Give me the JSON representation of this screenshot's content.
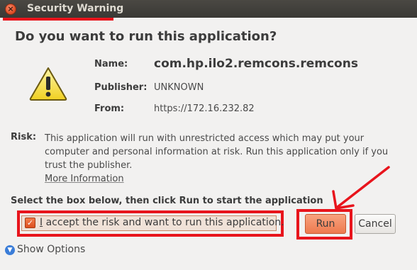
{
  "window": {
    "title": "Security Warning",
    "close_glyph": "×"
  },
  "dialog": {
    "question": "Do you want to run this application?",
    "name_label": "Name:",
    "name_value": "com.hp.ilo2.remcons.remcons",
    "publisher_label": "Publisher:",
    "publisher_value": "UNKNOWN",
    "from_label": "From:",
    "from_value": "https://172.16.232.82",
    "risk_label": "Risk:",
    "risk_text": "This application will run with unrestricted access which may put your computer and personal information at risk. Run this application only if you trust the publisher.",
    "more_info": "More Information",
    "instruction": "Select the box below, then click Run to start the application",
    "accept_label": "I accept the risk and want to run this application.",
    "accept_checked": true,
    "run_label": "Run",
    "cancel_label": "Cancel",
    "show_options": "Show Options"
  },
  "icons": {
    "warning": "warning-triangle-icon",
    "close": "close-icon",
    "expand": "chevron-down-icon"
  },
  "colors": {
    "annotation": "#e8141c",
    "accent": "#ee7a4f",
    "titlebar": "#3c3b37"
  }
}
